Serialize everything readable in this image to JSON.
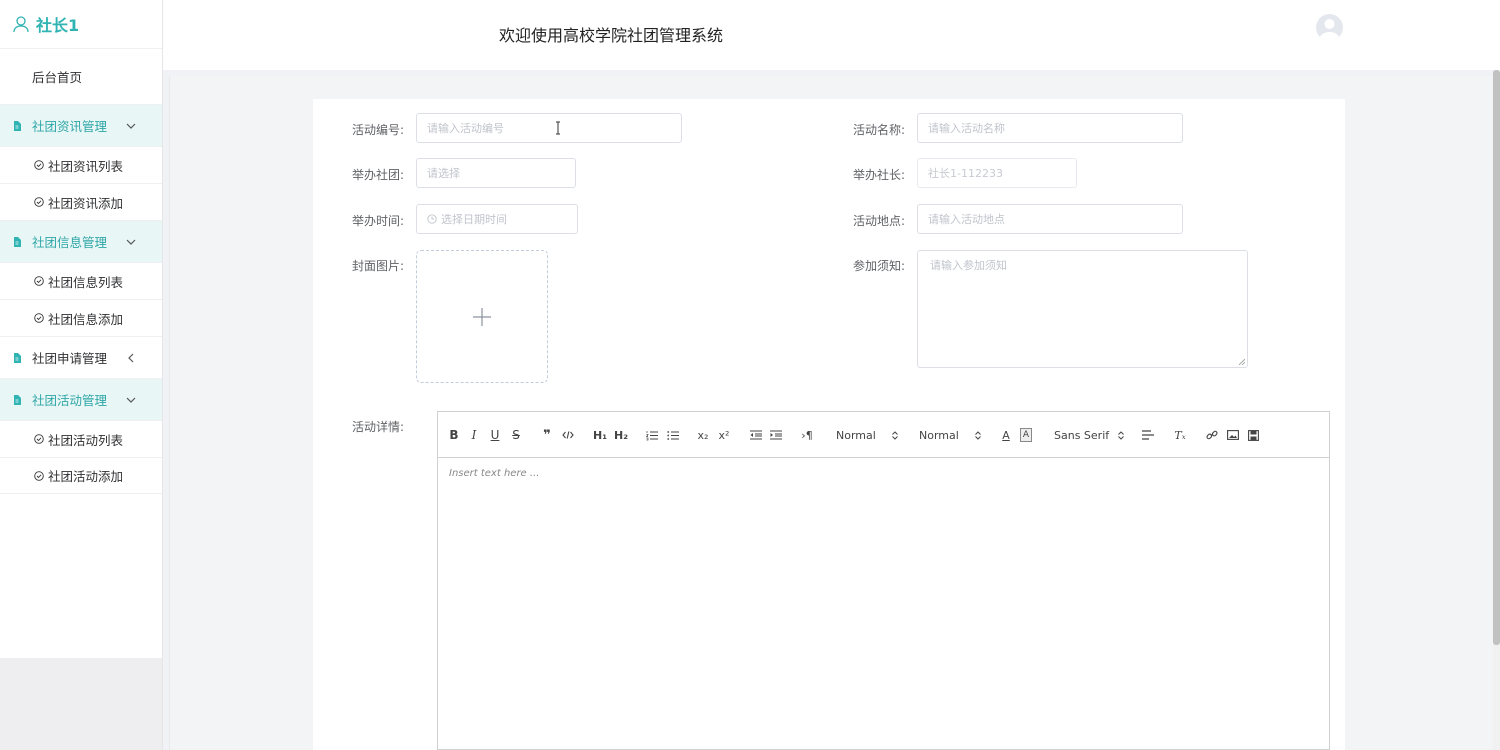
{
  "sidebar": {
    "brand": "社长1",
    "home": "后台首页",
    "groups": [
      {
        "label": "社团资讯管理",
        "items": [
          "社团资讯列表",
          "社团资讯添加"
        ]
      },
      {
        "label": "社团信息管理",
        "items": [
          "社团信息列表",
          "社团信息添加"
        ]
      },
      {
        "label": "社团申请管理",
        "items": []
      },
      {
        "label": "社团活动管理",
        "items": [
          "社团活动列表",
          "社团活动添加"
        ]
      }
    ]
  },
  "header": {
    "title": "欢迎使用高校学院社团管理系统"
  },
  "form": {
    "activity_no": {
      "label": "活动编号:",
      "placeholder": "请输入活动编号"
    },
    "activity_name": {
      "label": "活动名称:",
      "placeholder": "请输入活动名称"
    },
    "club": {
      "label": "举办社团:",
      "placeholder": "请选择"
    },
    "president": {
      "label": "举办社长:",
      "value": "社长1-112233"
    },
    "time": {
      "label": "举办时间:",
      "placeholder": "选择日期时间"
    },
    "location": {
      "label": "活动地点:",
      "placeholder": "请输入活动地点"
    },
    "cover": {
      "label": "封面图片:"
    },
    "notice": {
      "label": "参加须知:",
      "placeholder": "请输入参加须知"
    },
    "details": {
      "label": "活动详情:"
    }
  },
  "editor": {
    "header_select": "Normal",
    "size_select": "Normal",
    "font_select": "Sans Serif",
    "placeholder": "Insert text here ..."
  },
  "colors": {
    "accent": "#2fb3b3",
    "active_bg": "#e8f6f6"
  }
}
